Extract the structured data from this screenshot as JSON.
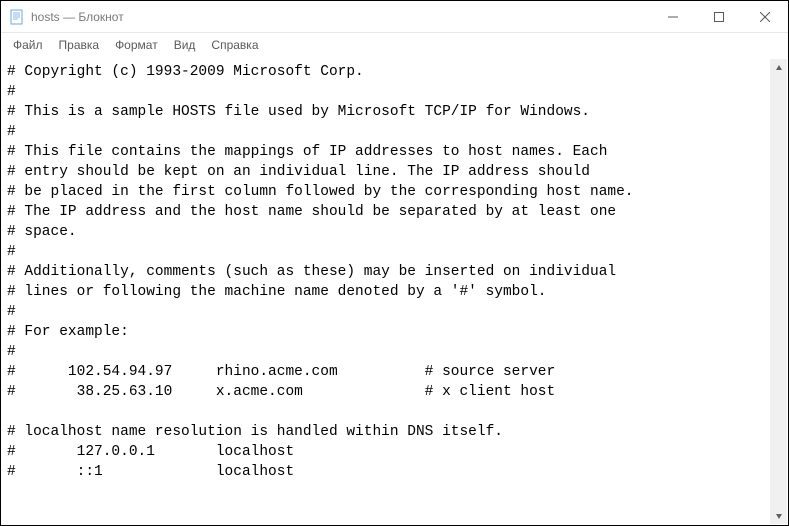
{
  "window": {
    "title": "hosts — Блокнот"
  },
  "menu": {
    "file": "Файл",
    "edit": "Правка",
    "format": "Формат",
    "view": "Вид",
    "help": "Справка"
  },
  "content": {
    "lines": [
      "# Copyright (c) 1993-2009 Microsoft Corp.",
      "#",
      "# This is a sample HOSTS file used by Microsoft TCP/IP for Windows.",
      "#",
      "# This file contains the mappings of IP addresses to host names. Each",
      "# entry should be kept on an individual line. The IP address should",
      "# be placed in the first column followed by the corresponding host name.",
      "# The IP address and the host name should be separated by at least one",
      "# space.",
      "#",
      "# Additionally, comments (such as these) may be inserted on individual",
      "# lines or following the machine name denoted by a '#' symbol.",
      "#",
      "# For example:",
      "#",
      "#      102.54.94.97     rhino.acme.com          # source server",
      "#       38.25.63.10     x.acme.com              # x client host",
      "",
      "# localhost name resolution is handled within DNS itself.",
      "#       127.0.0.1       localhost",
      "#       ::1             localhost"
    ]
  }
}
